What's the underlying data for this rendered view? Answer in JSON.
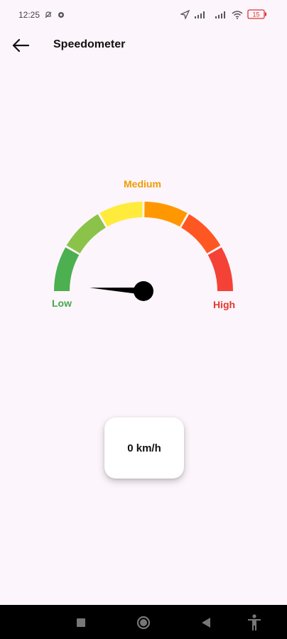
{
  "status_bar": {
    "time": "12:25",
    "battery": "15"
  },
  "app_bar": {
    "title": "Speedometer"
  },
  "gauge": {
    "label_low": "Low",
    "label_medium": "Medium",
    "label_high": "High",
    "segments": [
      {
        "color": "#4CAF50"
      },
      {
        "color": "#8BC34A"
      },
      {
        "color": "#FFEB3B"
      },
      {
        "color": "#FF9800"
      },
      {
        "color": "#FF5722"
      },
      {
        "color": "#F44336"
      }
    ],
    "needle_fraction": 0.02
  },
  "speed": {
    "text": "0 km/h"
  },
  "icons": {
    "back": "arrow-back-icon",
    "nav_recent": "square-icon",
    "nav_home": "circle-icon",
    "nav_back": "triangle-back-icon",
    "nav_accessibility": "accessibility-icon"
  }
}
